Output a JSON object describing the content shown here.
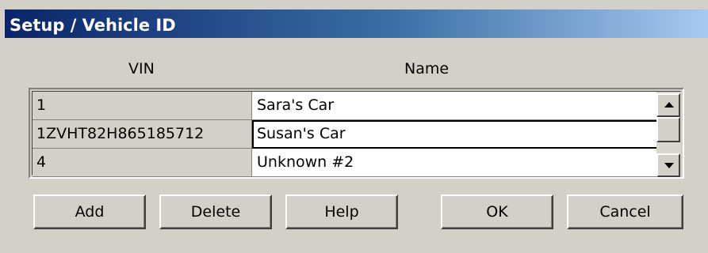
{
  "window": {
    "title": "Setup / Vehicle ID"
  },
  "grid": {
    "columns": [
      "VIN",
      "Name"
    ],
    "rows": [
      {
        "vin": "1",
        "name": "Sara's Car"
      },
      {
        "vin": "1ZVHT82H865185712",
        "name": "Susan's Car"
      },
      {
        "vin": "4",
        "name": "Unknown #2"
      }
    ],
    "editing_row": 1
  },
  "buttons": {
    "add": "Add",
    "delete": "Delete",
    "help": "Help",
    "ok": "OK",
    "cancel": "Cancel"
  },
  "icons": {
    "scroll_up": "scroll-up-arrow-icon",
    "scroll_down": "scroll-down-arrow-icon"
  }
}
